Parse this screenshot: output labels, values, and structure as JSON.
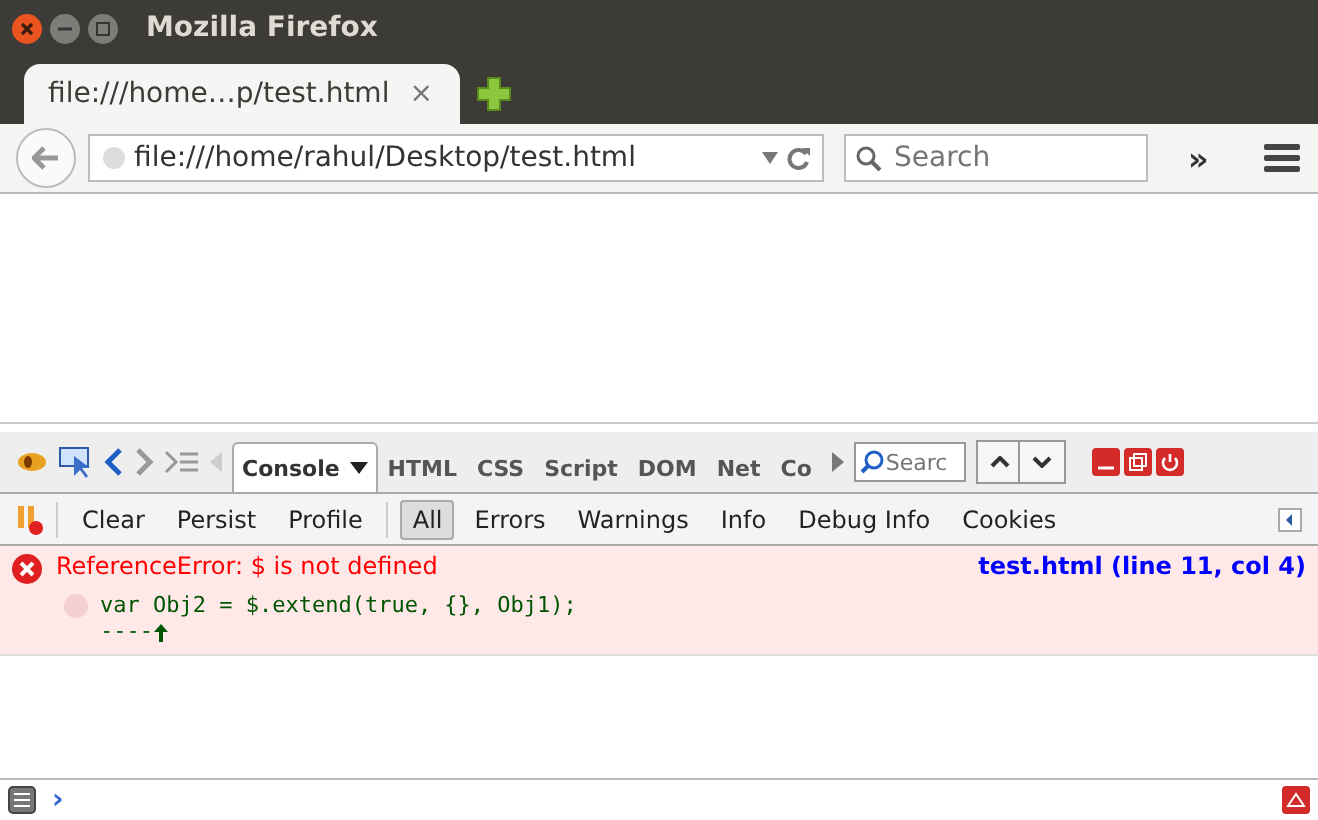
{
  "window": {
    "title": "Mozilla Firefox"
  },
  "tabs": [
    {
      "label": "file:///home…p/test.html",
      "close": "×",
      "selected": true
    }
  ],
  "navbar": {
    "url": "file:///home/rahul/Desktop/test.html",
    "search": {
      "placeholder": "Search"
    },
    "overflow": "»"
  },
  "firebug": {
    "panels": [
      {
        "label": "Console",
        "selected": true
      },
      {
        "label": "HTML",
        "selected": false
      },
      {
        "label": "CSS",
        "selected": false
      },
      {
        "label": "Script",
        "selected": false
      },
      {
        "label": "DOM",
        "selected": false
      },
      {
        "label": "Net",
        "selected": false
      },
      {
        "label": "Co",
        "selected": false
      }
    ],
    "search": {
      "placeholder": "Searc"
    },
    "actions": [
      "Clear",
      "Persist",
      "Profile"
    ],
    "filters": [
      {
        "label": "All",
        "selected": true
      },
      {
        "label": "Errors",
        "selected": false
      },
      {
        "label": "Warnings",
        "selected": false
      },
      {
        "label": "Info",
        "selected": false
      },
      {
        "label": "Debug Info",
        "selected": false
      },
      {
        "label": "Cookies",
        "selected": false
      }
    ],
    "log": [
      {
        "kind": "error",
        "message": "ReferenceError: $ is not defined",
        "source": "test.html (line 11, col 4)",
        "code": "var Obj2 = $.extend(true, {}, Obj1);",
        "pointer": "----"
      }
    ],
    "prompt": "›"
  }
}
